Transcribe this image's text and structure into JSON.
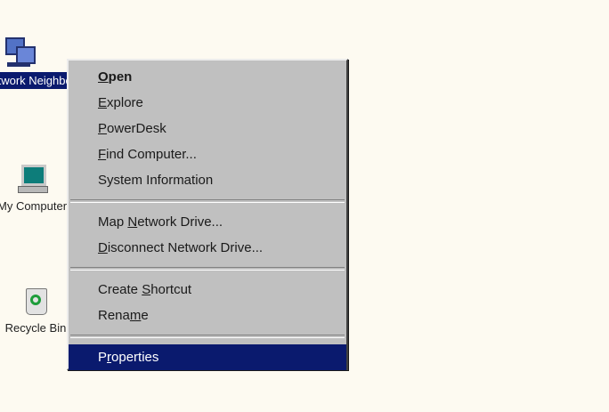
{
  "desktop": {
    "icons": [
      {
        "label": "Network Neighborhood",
        "selected": true,
        "icon": "network-neighborhood-icon"
      },
      {
        "label": "My Computer",
        "selected": false,
        "icon": "my-computer-icon"
      },
      {
        "label": "Recycle Bin",
        "selected": false,
        "icon": "recycle-bin-icon"
      }
    ]
  },
  "context_menu": {
    "groups": [
      [
        {
          "key": "O",
          "pre": "",
          "rest": "pen",
          "bold": true
        },
        {
          "key": "E",
          "pre": "",
          "rest": "xplore"
        },
        {
          "key": "P",
          "pre": "",
          "rest": "owerDesk"
        },
        {
          "key": "F",
          "pre": "",
          "rest": "ind Computer..."
        },
        {
          "key": "",
          "pre": "System Information",
          "rest": ""
        }
      ],
      [
        {
          "key": "N",
          "pre": "Map ",
          "rest": "etwork Drive..."
        },
        {
          "key": "D",
          "pre": "",
          "rest": "isconnect Network Drive..."
        }
      ],
      [
        {
          "key": "S",
          "pre": "Create ",
          "rest": "hortcut"
        },
        {
          "key": "m",
          "pre": "Rena",
          "rest": "e"
        }
      ],
      [
        {
          "key": "r",
          "pre": "P",
          "rest": "operties",
          "highlighted": true
        }
      ]
    ]
  },
  "colors": {
    "desktop_bg": "#fdfaf1",
    "menu_bg": "#c0c0c0",
    "selection": "#0a1a6e"
  }
}
